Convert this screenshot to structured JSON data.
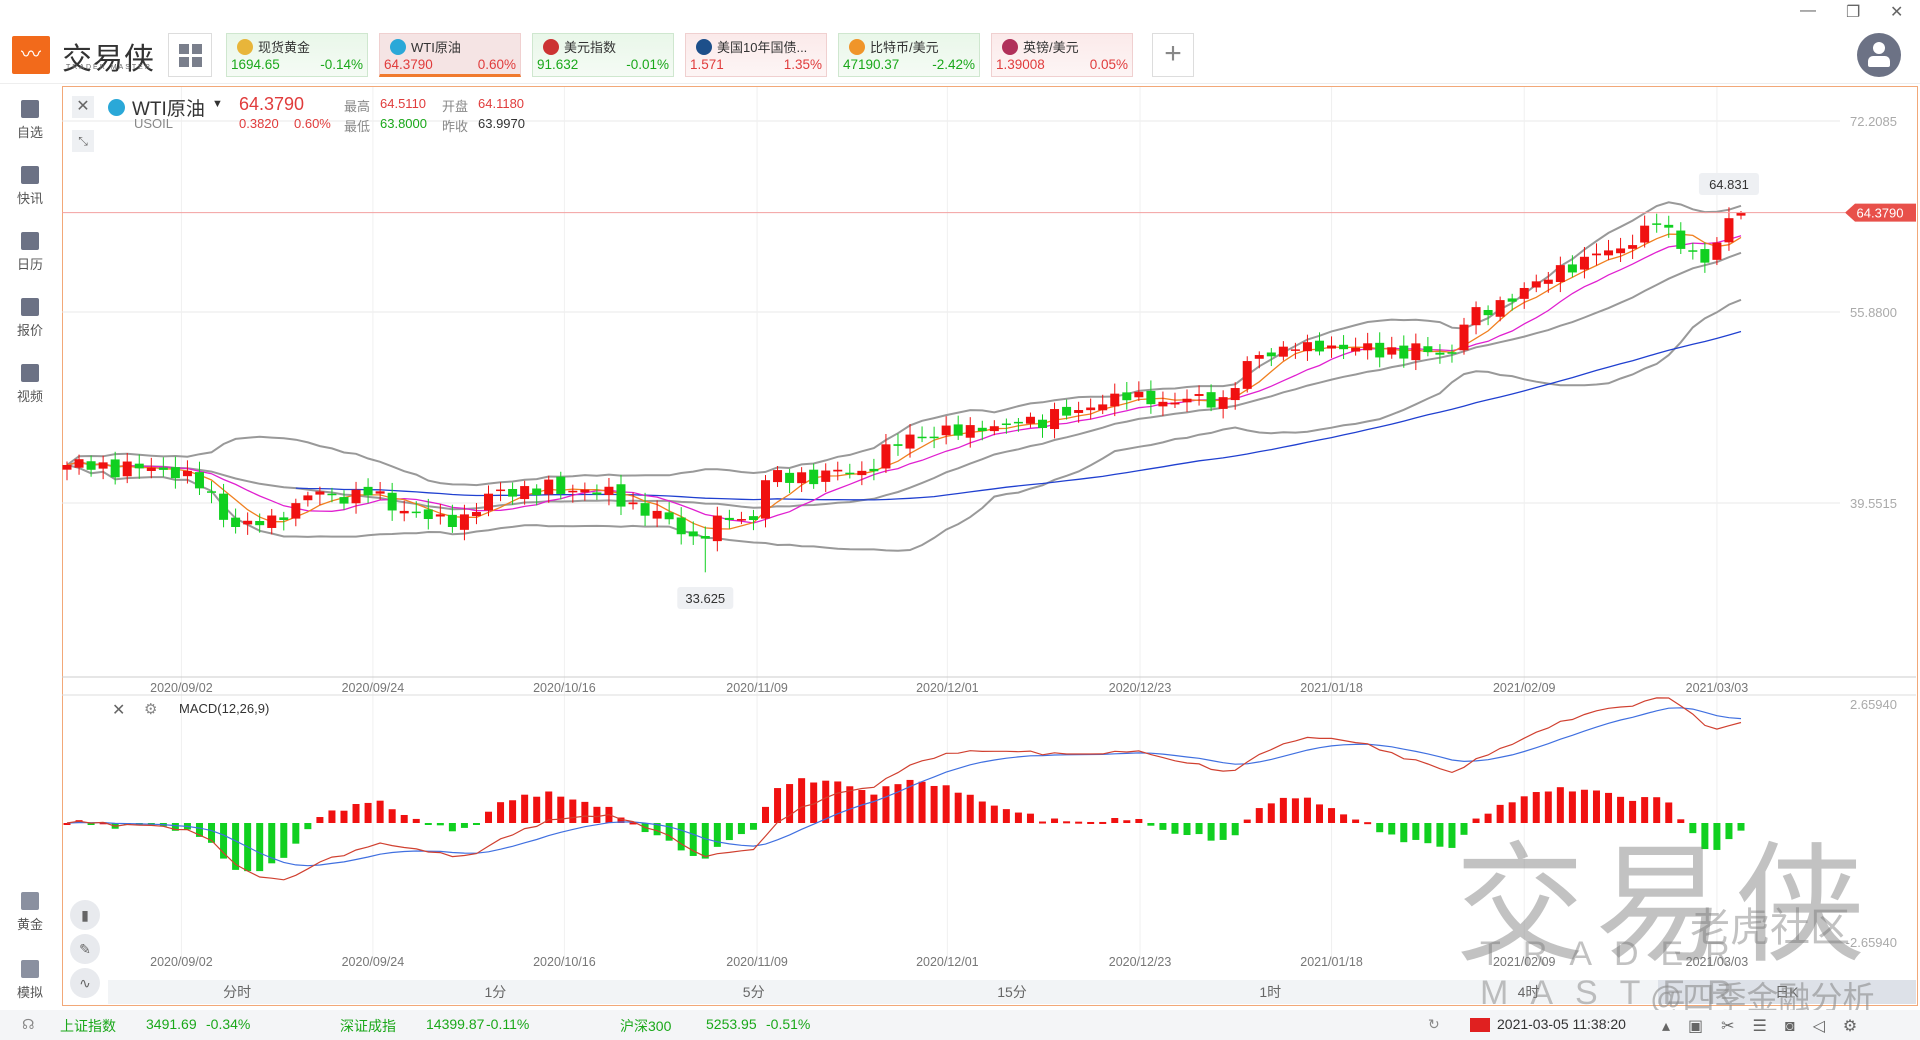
{
  "app": {
    "brand": "交易侠",
    "brand_sub": "TRADER MASTER",
    "logo_icon": "chart-logo-icon"
  },
  "window": {
    "minimize": "—",
    "restore": "❐",
    "close": "✕"
  },
  "tickers": [
    {
      "name": "现货黄金",
      "price": "1694.65",
      "change": "-0.14%",
      "trend": "down",
      "icon_color": "#e8b53a",
      "icon": "gold"
    },
    {
      "name": "WTI原油",
      "price": "64.3790",
      "change": "0.60%",
      "trend": "up",
      "icon_color": "#2aa8d8",
      "icon": "oil",
      "active": true
    },
    {
      "name": "美元指数",
      "price": "91.632",
      "change": "-0.01%",
      "trend": "down",
      "icon_color": "#c33",
      "icon": "us-flag"
    },
    {
      "name": "美国10年国债...",
      "price": "1.571",
      "change": "1.35%",
      "trend": "up",
      "icon_color": "#1d4f8a",
      "icon": "bond"
    },
    {
      "name": "比特币/美元",
      "price": "47190.37",
      "change": "-2.42%",
      "trend": "down",
      "icon_color": "#f0952a",
      "icon": "bitcoin"
    },
    {
      "name": "英镑/美元",
      "price": "1.39008",
      "change": "0.05%",
      "trend": "up",
      "icon_color": "#b0305a",
      "icon": "uk-flag"
    }
  ],
  "plus": "+",
  "sidebar": {
    "top": [
      "自选",
      "快讯",
      "日历",
      "报价",
      "视频"
    ],
    "bottom": [
      "黄金",
      "模拟"
    ]
  },
  "symbol": {
    "name": "WTI原油",
    "code": "USOIL",
    "price": "64.3790",
    "change": "0.3820",
    "pct": "0.60%",
    "high_label": "最高",
    "high": "64.5110",
    "open_label": "开盘",
    "open": "64.1180",
    "low_label": "最低",
    "low": "63.8000",
    "prev_label": "昨收",
    "prev": "63.9970"
  },
  "colors": {
    "up": "#f01010",
    "down": "#10d020",
    "ma5": "#f08020",
    "ma10": "#e020d0",
    "ma60": "#2040d0",
    "boll": "#999999",
    "accent": "#f26a1b"
  },
  "chart_data": [
    {
      "type": "candlestick",
      "title": "WTI原油 日K",
      "y_ticks": [
        "72.2085",
        "55.8800",
        "39.5515"
      ],
      "ylim": [
        39.5515,
        72.2085
      ],
      "x_ticks": [
        {
          "label": "2020/09/02",
          "index": 9.5
        },
        {
          "label": "2020/09/24",
          "index": 25.4
        },
        {
          "label": "2020/10/16",
          "index": 41.3
        },
        {
          "label": "2020/11/09",
          "index": 57.3
        },
        {
          "label": "2020/12/01",
          "index": 73.1
        },
        {
          "label": "2020/12/23",
          "index": 89.1
        },
        {
          "label": "2021/01/18",
          "index": 105
        },
        {
          "label": "2021/02/09",
          "index": 121
        },
        {
          "label": "2021/03/03",
          "index": 137
        }
      ],
      "num_candles": 140,
      "close_keypoints": [
        [
          0,
          42.8
        ],
        [
          10,
          42.3
        ],
        [
          14,
          37.5
        ],
        [
          18,
          38.1
        ],
        [
          20,
          40.2
        ],
        [
          25,
          40.2
        ],
        [
          32,
          37.5
        ],
        [
          36,
          40.7
        ],
        [
          43,
          40.7
        ],
        [
          47,
          39.6
        ],
        [
          52,
          36.7
        ],
        [
          55,
          38.1
        ],
        [
          57,
          38.1
        ],
        [
          58,
          41.5
        ],
        [
          66,
          42.3
        ],
        [
          70,
          45.4
        ],
        [
          76,
          45.7
        ],
        [
          84,
          47.5
        ],
        [
          87,
          48.9
        ],
        [
          90,
          48.0
        ],
        [
          96,
          48.6
        ],
        [
          99,
          52.2
        ],
        [
          103,
          53.3
        ],
        [
          106,
          52.7
        ],
        [
          115,
          52.4
        ],
        [
          116,
          54.8
        ],
        [
          122,
          58.5
        ],
        [
          126,
          60.6
        ],
        [
          130,
          61.6
        ],
        [
          132,
          63.4
        ],
        [
          135,
          61.1
        ],
        [
          136,
          60.1
        ],
        [
          138,
          63.9
        ],
        [
          139,
          64.379
        ]
      ],
      "current_price": "64.3790",
      "max_marker": "64.831",
      "min_marker": "33.625",
      "min_index": 53,
      "max_index": 138
    },
    {
      "type": "macd",
      "title": "MACD(12,26,9)",
      "y_ticks": [
        "2.65940",
        "-2.65940"
      ],
      "ylim": [
        -2.6594,
        2.6594
      ]
    }
  ],
  "timeframes": [
    "分时",
    "1分",
    "5分",
    "15分",
    "1时",
    "4时",
    "日K"
  ],
  "active_timeframe": "日K",
  "status": {
    "indices": [
      {
        "name": "上证指数",
        "value": "3491.69",
        "change": "-0.34%"
      },
      {
        "name": "深证成指",
        "value": "14399.87",
        "change": "-0.11%"
      },
      {
        "name": "沪深300",
        "value": "5253.95",
        "change": "-0.51%"
      }
    ],
    "datetime": "2021-03-05 11:38:20"
  },
  "watermarks": {
    "brand": "交易侠",
    "brand_en": "TRADER MASTER",
    "community": "老虎社区",
    "author": "@四季金融分析"
  }
}
